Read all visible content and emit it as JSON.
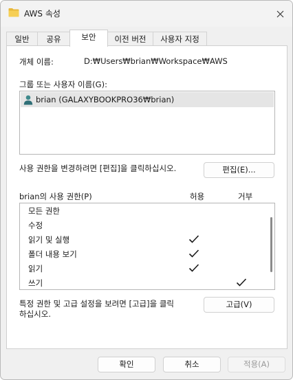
{
  "window": {
    "title": "AWS 속성"
  },
  "tabs": [
    {
      "label": "일반",
      "active": false
    },
    {
      "label": "공유",
      "active": false
    },
    {
      "label": "보안",
      "active": true
    },
    {
      "label": "이전 버전",
      "active": false
    },
    {
      "label": "사용자 지정",
      "active": false
    }
  ],
  "security": {
    "object_name_label": "개체 이름:",
    "object_name_value": "D:₩Users₩brian₩Workspace₩AWS",
    "groups_label": "그룹 또는 사용자 이름(G):",
    "groups": [
      {
        "name": "brian (GALAXYBOOKPRO36₩brian)",
        "selected": true
      }
    ],
    "edit_hint": "사용 권한을 변경하려면 [편집]을 클릭하십시오.",
    "edit_button": "편집(E)...",
    "permissions_label": "brian의 사용 권한(P)",
    "allow_header": "허용",
    "deny_header": "거부",
    "permissions": [
      {
        "name": "모든 권한",
        "allow": false,
        "deny": false
      },
      {
        "name": "수정",
        "allow": false,
        "deny": false
      },
      {
        "name": "읽기 및 실행",
        "allow": true,
        "deny": false
      },
      {
        "name": "폴더 내용 보기",
        "allow": true,
        "deny": false
      },
      {
        "name": "읽기",
        "allow": true,
        "deny": false
      },
      {
        "name": "쓰기",
        "allow": false,
        "deny": true
      }
    ],
    "advanced_hint_line1": "특정 권한 및 고급 설정을 보려면 [고급]을 클릭",
    "advanced_hint_line2": "하십시오.",
    "advanced_button": "고급(V)"
  },
  "footer": {
    "ok": "확인",
    "cancel": "취소",
    "apply": "적용(A)"
  },
  "colors": {
    "folder": "#e8b83a",
    "selection": "#e5e5e5"
  },
  "icons": {
    "title": "folder-icon",
    "close": "close-icon",
    "user": "user-icon",
    "check": "checkmark-icon"
  }
}
